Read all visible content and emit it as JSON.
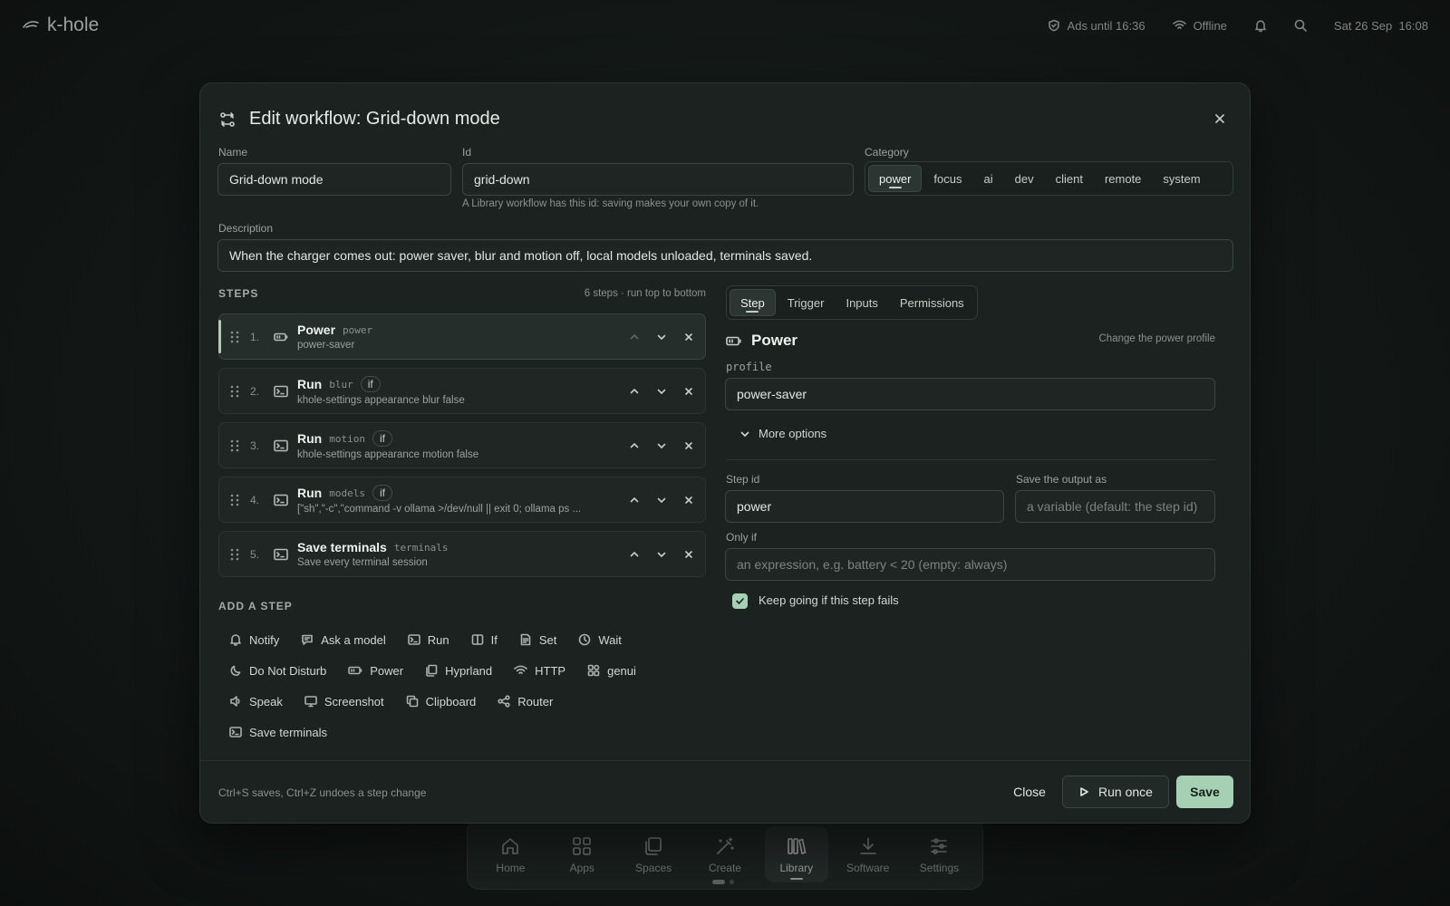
{
  "topbar": {
    "app_name": "k-hole",
    "ads": "Ads until 16:36",
    "network": "Offline",
    "datetime": "Sat 26 Sep  16:08"
  },
  "dock": {
    "items": [
      {
        "label": "Home",
        "icon": "home-icon"
      },
      {
        "label": "Apps",
        "icon": "apps-icon"
      },
      {
        "label": "Spaces",
        "icon": "spaces-icon"
      },
      {
        "label": "Create",
        "icon": "create-icon"
      },
      {
        "label": "Library",
        "icon": "library-icon",
        "active": true
      },
      {
        "label": "Software",
        "icon": "download-icon"
      },
      {
        "label": "Settings",
        "icon": "settings-icon"
      }
    ]
  },
  "modal": {
    "title": "Edit workflow: Grid-down mode",
    "name_label": "Name",
    "name_value": "Grid-down mode",
    "id_label": "Id",
    "id_value": "grid-down",
    "id_hint": "A Library workflow has this id: saving makes your own copy of it.",
    "category_label": "Category",
    "categories": [
      "power",
      "focus",
      "ai",
      "dev",
      "client",
      "remote",
      "system"
    ],
    "category_selected": "power",
    "description_label": "Description",
    "description_value": "When the charger comes out: power saver, blur and motion off, local models unloaded, terminals saved.",
    "steps_heading": "STEPS",
    "steps_count": "6 steps · run top to bottom",
    "steps": [
      {
        "num": "1.",
        "name": "Power",
        "id": "power",
        "if": "",
        "sub": "power-saver",
        "icon": "battery-icon"
      },
      {
        "num": "2.",
        "name": "Run",
        "id": "blur",
        "if": "if",
        "sub": "khole-settings appearance blur false",
        "icon": "terminal-icon"
      },
      {
        "num": "3.",
        "name": "Run",
        "id": "motion",
        "if": "if",
        "sub": "khole-settings appearance motion false",
        "icon": "terminal-icon"
      },
      {
        "num": "4.",
        "name": "Run",
        "id": "models",
        "if": "if",
        "sub": "[\"sh\",\"-c\",\"command -v ollama >/dev/null || exit 0; ollama ps ...",
        "icon": "terminal-icon"
      },
      {
        "num": "5.",
        "name": "Save terminals",
        "id": "terminals",
        "if": "",
        "sub": "Save every terminal session",
        "icon": "terminal-icon"
      }
    ],
    "add_step_heading": "ADD A STEP",
    "add_steps": [
      [
        {
          "label": "Notify",
          "icon": "bell-icon"
        },
        {
          "label": "Ask a model",
          "icon": "chat-icon"
        },
        {
          "label": "Run",
          "icon": "terminal-icon"
        },
        {
          "label": "If",
          "icon": "split-icon"
        },
        {
          "label": "Set",
          "icon": "document-icon"
        },
        {
          "label": "Wait",
          "icon": "clock-icon"
        }
      ],
      [
        {
          "label": "Do Not Disturb",
          "icon": "moon-icon"
        },
        {
          "label": "Power",
          "icon": "battery-icon"
        },
        {
          "label": "Hyprland",
          "icon": "windows-icon"
        },
        {
          "label": "HTTP",
          "icon": "wifi-icon"
        },
        {
          "label": "genui",
          "icon": "widgets-icon"
        }
      ],
      [
        {
          "label": "Speak",
          "icon": "speaker-icon"
        },
        {
          "label": "Screenshot",
          "icon": "monitor-icon"
        },
        {
          "label": "Clipboard",
          "icon": "clipboard-icon"
        },
        {
          "label": "Router",
          "icon": "share-icon"
        }
      ],
      [
        {
          "label": "Save terminals",
          "icon": "terminal-icon"
        }
      ]
    ],
    "right_tabs": [
      "Step",
      "Trigger",
      "Inputs",
      "Permissions"
    ],
    "right_tab_selected": "Step",
    "step_title": "Power",
    "step_desc": "Change the power profile",
    "profile_label": "profile",
    "profile_value": "power-saver",
    "more_options": "More options",
    "step_id_label": "Step id",
    "step_id_value": "power",
    "save_output_label": "Save the output as",
    "save_output_placeholder": "a variable (default: the step id)",
    "only_if_label": "Only if",
    "only_if_placeholder": "an expression, e.g. battery < 20 (empty: always)",
    "keep_going_label": "Keep going if this step fails",
    "keep_going_checked": true,
    "footer_hint": "Ctrl+S saves, Ctrl+Z undoes a step change",
    "close_label": "Close",
    "run_once_label": "Run once",
    "save_label": "Save",
    "accent": "#a5d0b4"
  }
}
